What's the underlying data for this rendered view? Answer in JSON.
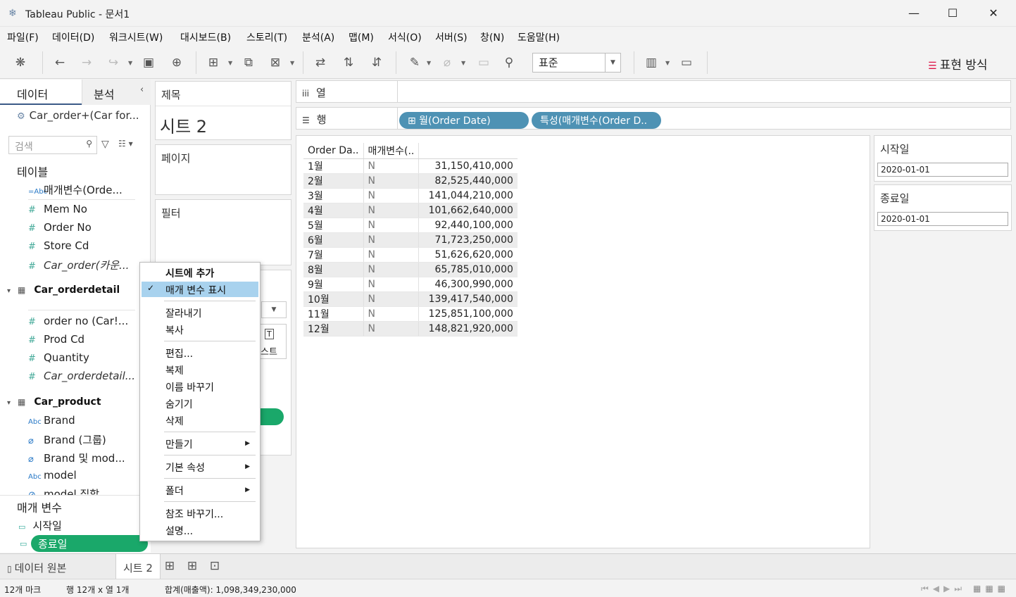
{
  "window": {
    "title": "Tableau Public - 문서1"
  },
  "menu": [
    "파일(F)",
    "데이터(D)",
    "워크시트(W)",
    "대시보드(B)",
    "스토리(T)",
    "분석(A)",
    "맵(M)",
    "서식(O)",
    "서버(S)",
    "창(N)",
    "도움말(H)"
  ],
  "toolbar": {
    "fit_value": "표준",
    "show_me": "표현 방식"
  },
  "data_pane": {
    "tab_data": "데이터",
    "tab_analysis": "분석",
    "datasource": "Car_order+(Car for...",
    "search_placeholder": "검색",
    "tables_label": "테이블",
    "fields_top": [
      {
        "icon": "=Abc",
        "name": "매개변수(Orde...",
        "italic": false
      },
      {
        "icon": "#",
        "name": "Mem No",
        "italic": false
      },
      {
        "icon": "#",
        "name": "Order No",
        "italic": false
      },
      {
        "icon": "#",
        "name": "Store Cd",
        "italic": false
      },
      {
        "icon": "#",
        "name": "Car_order(카운...",
        "italic": true
      }
    ],
    "table2": "Car_orderdetail",
    "fields_detail": [
      {
        "icon": "#",
        "name": "order no (Car!..."
      },
      {
        "icon": "#",
        "name": "Prod Cd"
      },
      {
        "icon": "#",
        "name": "Quantity"
      },
      {
        "icon": "#",
        "name": "Car_orderdetail..."
      }
    ],
    "table3": "Car_product",
    "fields_product": [
      {
        "icon": "Abc",
        "name": "Brand"
      },
      {
        "icon": "@",
        "name": "Brand (그룹)"
      },
      {
        "icon": "@",
        "name": "Brand 및 mod..."
      },
      {
        "icon": "Abc",
        "name": "model"
      },
      {
        "icon": "@",
        "name": "model 집합"
      }
    ],
    "params_label": "매개 변수",
    "params": [
      "시작일",
      "종료일"
    ]
  },
  "cards": {
    "title_label": "제목",
    "sheet_title": "시트 2",
    "pages_label": "페이지",
    "filters_label": "필터",
    "text_fragment": "스트"
  },
  "shelves": {
    "columns_label": "열",
    "rows_label": "행",
    "rows_pills": [
      "⊞ 월(Order Date)",
      "특성(매개변수(Order D.."
    ]
  },
  "view_table": {
    "headers": [
      "Order Da..",
      "매개변수(..",
      ""
    ],
    "rows": [
      [
        "1월",
        "N",
        "31,150,410,000"
      ],
      [
        "2월",
        "N",
        "82,525,440,000"
      ],
      [
        "3월",
        "N",
        "141,044,210,000"
      ],
      [
        "4월",
        "N",
        "101,662,640,000"
      ],
      [
        "5월",
        "N",
        "92,440,100,000"
      ],
      [
        "6월",
        "N",
        "71,723,250,000"
      ],
      [
        "7월",
        "N",
        "51,626,620,000"
      ],
      [
        "8월",
        "N",
        "65,785,010,000"
      ],
      [
        "9월",
        "N",
        "46,300,990,000"
      ],
      [
        "10월",
        "N",
        "139,417,540,000"
      ],
      [
        "11월",
        "N",
        "125,851,100,000"
      ],
      [
        "12월",
        "N",
        "148,821,920,000"
      ]
    ]
  },
  "param_cards": [
    {
      "label": "시작일",
      "value": "2020-01-01"
    },
    {
      "label": "종료일",
      "value": "2020-01-01"
    }
  ],
  "context_menu": {
    "header": "시트에 추가",
    "checked": "매개 변수 표시",
    "group1": [
      "잘라내기",
      "복사"
    ],
    "group2": [
      "편집...",
      "복제",
      "이름 바꾸기",
      "숨기기",
      "삭제"
    ],
    "submenus": [
      "만들기",
      "기본 속성",
      "폴더"
    ],
    "group3": [
      "참조 바꾸기...",
      "설명..."
    ]
  },
  "bottom_tabs": {
    "datasource": "데이터 원본",
    "sheet": "시트 2"
  },
  "status": {
    "marks": "12개 마크",
    "rows_cols": "행 12개  x  열 1개",
    "sum": "합계(매출액): 1,098,349,230,000"
  }
}
